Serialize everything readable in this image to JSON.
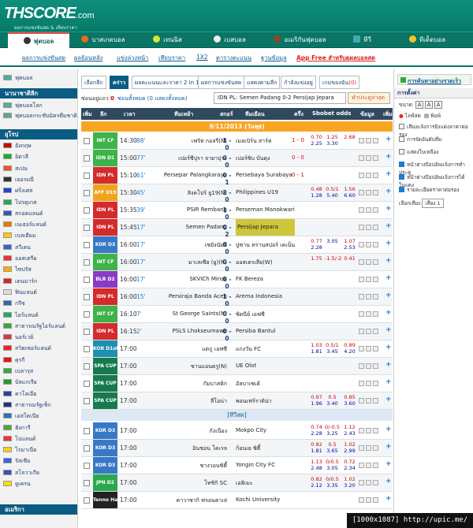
{
  "site": {
    "logo": "THSCORE",
    "logo_domain": ".com",
    "tagline": "ผลการแข่งขันสด & เทียบราคา"
  },
  "nav": [
    "ฟุตบอล",
    "บาสเกตบอล",
    "เทนนิส",
    "เบสบอล",
    "อเมริกันฟุตบอล",
    "ทีวี",
    "ทีเด็ดบอล"
  ],
  "sub": [
    "ผลการแข่งขันสด",
    "ผลย้อนหลัง",
    "แข่งล่วงหน้า",
    "เทียบราคา",
    "1X2",
    "ตารางคะแนน",
    "ฐานข้อมูล",
    "App Free สำหรับดูผลบอลสด"
  ],
  "left": {
    "head1": "ฟุตบอล",
    "head2": "นานาชาติลีก",
    "head3": "ยุโรป",
    "head4": "อเมริกา",
    "intl": [
      "ฟุตบอลโลก",
      "ฟุตบอลกระชับมิตรทีมชาติ"
    ],
    "eu": [
      "อังกฤษ",
      "อิตาลี",
      "สเปน",
      "เยอรมนี",
      "ฝรั่งเศส",
      "โปรตุเกส",
      "สกอตแลนด์",
      "เนเธอร์แลนด์",
      "เบลเยียม",
      "สวีเดน",
      "ออสเตรีย",
      "ไซปรัส",
      "เดนมาร์ก",
      "ฟินแลนด์",
      "กรีซ",
      "ไอร์แลนด์",
      "สาธารณรัฐไอร์แลนด์",
      "นอร์เวย์",
      "สวิตเซอร์แลนด์",
      "ตุรกี",
      "เบลารุส",
      "บัลแกเรีย",
      "คาโลเอีย",
      "สาธารณรัฐเช็ก",
      "เอสโตเนีย",
      "ฮังการี",
      "โปแลนด์",
      "โรมาเนีย",
      "รัสเซีย",
      "สโลวาเกีย",
      "ยูเครน"
    ]
  },
  "filters": [
    "เลือกลีก",
    "คร่าว",
    "ผลคะแนนและราคา 2 in 1",
    "ผลการแข่งขันสด",
    "แสดงตามลีก",
    "กำลังแข่งอยู่",
    "เกมของฉัน"
  ],
  "my_games_count": "(0)",
  "opts": {
    "hidden": "ซ่อนอยู่แถว",
    "hidden_count": "0",
    "show_all": "ซ่อนทั้งหมด",
    "show_count": "(0 แสดงทั้งหมด)",
    "match_select": "IDN PL: Semen Padang 0-2 Persijap Jepara",
    "sort": "ทำประตูล่าสุด"
  },
  "thead": [
    "เพิ่ม",
    "ลีก",
    "เวลา",
    "ทีมเหย้า",
    "สกอร์",
    "ทีมเยือน",
    "ครึ่ง",
    "Sbobet odds",
    "ข้อมูล",
    "เพิ่ม"
  ],
  "date": "9/11/2013 (วันพุธ)",
  "tv": "[ทีวีสด]",
  "matches": [
    {
      "league": "INT CF",
      "color": "#3db34a",
      "time": "14:30",
      "status": "88'",
      "home": "เฟรัท กอลรี(N)",
      "score": "1 - 0",
      "away": "เมลเบิร์น สาร์ท",
      "ht": "1 - 0",
      "o": [
        [
          "0.70",
          "2.25"
        ],
        [
          "1.25",
          "3.30"
        ],
        [
          "2.68",
          ""
        ]
      ]
    },
    {
      "league": "IDN D1",
      "color": "#3db34a",
      "time": "15:00",
      "status": "77'",
      "home": "เปอร์ซีปุรา จายาปุระ",
      "score": "0 - 0",
      "away": "เปอร์ซิบ บันดุง",
      "ht": "0 - 0",
      "o": [
        [
          "",
          ""
        ],
        [
          "",
          ""
        ],
        [
          "",
          ""
        ]
      ]
    },
    {
      "league": "IDN PL",
      "color": "#d42b2b",
      "time": "15:10",
      "status": "61'",
      "home": "Persepar Palangkaraya",
      "score": "0 - 1",
      "away": "Persebaya Surabaya",
      "ht": "0 - 1",
      "o": [
        [
          "",
          ""
        ],
        [
          "",
          ""
        ],
        [
          "",
          ""
        ]
      ]
    },
    {
      "league": "AFF U19",
      "color": "#f0a31c",
      "time": "15:30",
      "status": "45'",
      "home": "สิงคโปร์ ยู19(N)",
      "score": "2 - 0",
      "away": "Philippines U19",
      "ht": "",
      "o": [
        [
          "0.48",
          "1.28"
        ],
        [
          "0.5/1",
          "5.40"
        ],
        [
          "1.56",
          "6.60"
        ]
      ]
    },
    {
      "league": "IDN PL",
      "color": "#d42b2b",
      "time": "15:35",
      "status": "39'",
      "home": "PSIR Rembang",
      "score": "1 - 0",
      "away": "Perseman Manokwari",
      "ht": "",
      "o": [
        [
          "",
          ""
        ],
        [
          "",
          ""
        ],
        [
          "",
          ""
        ]
      ]
    },
    {
      "league": "IDN PL",
      "color": "#d42b2b",
      "time": "15:45",
      "status": "17'",
      "home": "Semen Padang",
      "score": "0 - 2",
      "away": "Persijap Jepara",
      "ht": "",
      "o": [
        [
          "",
          ""
        ],
        [
          "",
          ""
        ],
        [
          "",
          ""
        ]
      ],
      "hl": true
    },
    {
      "league": "KOR D3",
      "color": "#3779c7",
      "time": "16:00",
      "status": "17'",
      "home": "เซยังนัมจี",
      "score": "0 - 0",
      "away": "ปูซาน ทรานสปอร์ เคเน็น",
      "ht": "",
      "o": [
        [
          "0.77",
          "2.28"
        ],
        [
          "",
          "3.05"
        ],
        [
          "1.07",
          "2.53"
        ]
      ]
    },
    {
      "league": "INT CF",
      "color": "#3db34a",
      "time": "16:00",
      "status": "17'",
      "home": "มาเลเซีย (ยู)(N)",
      "score": "0 - 0",
      "away": "ออสเตรเลีย(W)",
      "ht": "",
      "o": [
        [
          "1.75",
          ""
        ],
        [
          "-1.5/-2",
          ""
        ],
        [
          "0.41",
          ""
        ]
      ]
    },
    {
      "league": "BLR D2",
      "color": "#8a3ac5",
      "time": "16:00",
      "status": "17'",
      "home": "SKVICh Minsk",
      "score": "0 - 0",
      "away": "FK Bereza",
      "ht": "",
      "o": [
        [
          "",
          ""
        ],
        [
          "",
          ""
        ],
        [
          "",
          ""
        ]
      ]
    },
    {
      "league": "IDN PL",
      "color": "#d42b2b",
      "time": "16:00",
      "status": "15'",
      "home": "Persiraja Banda Aceh",
      "score": "1 - 0",
      "away": "Arema Indonesia",
      "ht": "",
      "o": [
        [
          "",
          ""
        ],
        [
          "",
          ""
        ],
        [
          "",
          ""
        ]
      ]
    },
    {
      "league": "INT CF",
      "color": "#3db34a",
      "time": "16:10",
      "status": "7'",
      "home": "St George Saints(N)",
      "score": "0 - 0",
      "away": "ซิดนีย์ เอฟซี",
      "ht": "",
      "o": [
        [
          "",
          ""
        ],
        [
          "",
          ""
        ],
        [
          "",
          ""
        ]
      ]
    },
    {
      "league": "IDN PL",
      "color": "#d42b2b",
      "time": "16:15",
      "status": "2'",
      "home": "PSLS Lhokseumawe",
      "score": "0 - 0",
      "away": "Persiba Bantul",
      "ht": "",
      "o": [
        [
          "",
          ""
        ],
        [
          "",
          ""
        ],
        [
          "",
          ""
        ]
      ]
    },
    {
      "league": "KOR D1off",
      "color": "#1e8fb0",
      "time": "17:00",
      "status": "",
      "home": "แดกู เอฟซี",
      "score": "",
      "away": "แกงวัน FC",
      "ht": "",
      "o": [
        [
          "1.03",
          "1.81"
        ],
        [
          "0.5/1",
          "3.45"
        ],
        [
          "0.89",
          "4.20"
        ]
      ]
    },
    {
      "league": "SPA CUP",
      "color": "#177a4e",
      "time": "17:00",
      "status": "",
      "home": "ซานแอนดรู(N)",
      "score": "",
      "away": "UE Olot",
      "ht": "",
      "o": [
        [
          "",
          ""
        ],
        [
          "",
          ""
        ],
        [
          "",
          ""
        ]
      ]
    },
    {
      "league": "SPA CUP",
      "color": "#177a4e",
      "time": "17:00",
      "status": "",
      "home": "กัมบาสติก",
      "score": "",
      "away": "อัลบาเซเต้",
      "ht": "",
      "o": [
        [
          "",
          ""
        ],
        [
          "",
          ""
        ],
        [
          "",
          ""
        ]
      ]
    },
    {
      "league": "SPA CUP",
      "color": "#177a4e",
      "time": "17:00",
      "status": "",
      "home": "ลีโอน่า",
      "score": "",
      "away": "พอนเฟร์ราดิน่า",
      "ht": "",
      "o": [
        [
          "0.97",
          "1.96"
        ],
        [
          "0.5",
          "3.40"
        ],
        [
          "0.85",
          "3.60"
        ]
      ]
    },
    {
      "league": "KOR D3",
      "color": "#3779c7",
      "time": "17:00",
      "status": "",
      "home": "กังเนือง",
      "score": "",
      "away": "Mokpo City",
      "ht": "",
      "o": [
        [
          "0.74",
          "2.28"
        ],
        [
          "0/-0.5",
          "3.25"
        ],
        [
          "1.12",
          "2.43"
        ]
      ]
    },
    {
      "league": "KOR D3",
      "color": "#3779c7",
      "time": "17:00",
      "status": "",
      "home": "อินชอน โคเรล",
      "score": "",
      "away": "ก้อนเย ซิตี้",
      "ht": "",
      "o": [
        [
          "0.82",
          "1.81"
        ],
        [
          "0.5",
          "3.65"
        ],
        [
          "1.02",
          "2.99"
        ]
      ]
    },
    {
      "league": "KOR D3",
      "color": "#3779c7",
      "time": "17:00",
      "status": "",
      "home": "ชางวอนซิตี้",
      "score": "",
      "away": "Yongin City FC",
      "ht": "",
      "o": [
        [
          "1.13",
          "2.48"
        ],
        [
          "0/0.5",
          "3.05"
        ],
        [
          "0.72",
          "2.34"
        ]
      ]
    },
    {
      "league": "JPN D2",
      "color": "#2aa84f",
      "time": "17:00",
      "status": "",
      "home": "โทชิกิ SC",
      "score": "",
      "away": "เอฮิเมะ",
      "ht": "",
      "o": [
        [
          "0.82",
          "2.12"
        ],
        [
          "0/0.5",
          "3.35"
        ],
        [
          "1.02",
          "3.20"
        ]
      ]
    },
    {
      "league": "Tenno Hai",
      "color": "#222222",
      "time": "17:00",
      "status": "",
      "home": "คาวาซากิ ฟรอนตาเล่",
      "score": "",
      "away": "Kochi University",
      "ht": "",
      "o": [
        [
          "",
          ""
        ],
        [
          "",
          ""
        ],
        [
          "",
          ""
        ]
      ]
    }
  ],
  "right": {
    "search": "การค้นหาอย่างรวดเร็ว",
    "settings": "การตั้งค่า",
    "size": "ขนาด:",
    "sizes": [
      "A",
      "A",
      "A"
    ],
    "print": "พิมพ์",
    "live": "ไลฟ์สด",
    "checks": [
      {
        "label": "เสียงแจ้งการยิงแต่งลาคาต่อรอง",
        "on": false
      },
      {
        "label": "การจัดอันดับทีม",
        "on": false
      },
      {
        "label": "แสดงใบเหลือง",
        "on": false
      },
      {
        "label": "หน้าต่างป๊อปอัพแจ้งการทำประตู",
        "on": true
      },
      {
        "label": "หน้าต่างป๊อปอัพแจ้งการได้ใบแดง",
        "on": true
      },
      {
        "label": "รายละเอียดราคาต่อรอง",
        "on": true
      }
    ],
    "sound": "เลือกเสียง",
    "sound_val": "เสียง 1"
  },
  "watermark": "[1000x1087] http://upic.me/"
}
